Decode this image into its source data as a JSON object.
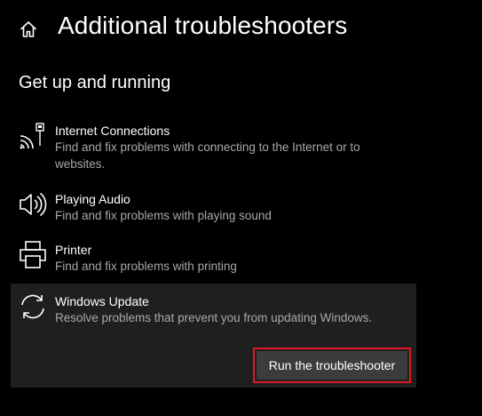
{
  "header": {
    "title": "Additional troubleshooters",
    "home_icon": "home-icon"
  },
  "section": {
    "heading": "Get up and running"
  },
  "items": [
    {
      "icon": "wifi-internet-icon",
      "title": "Internet Connections",
      "description": "Find and fix problems with connecting to the Internet or to websites."
    },
    {
      "icon": "speaker-icon",
      "title": "Playing Audio",
      "description": "Find and fix problems with playing sound"
    },
    {
      "icon": "printer-icon",
      "title": "Printer",
      "description": "Find and fix problems with printing"
    },
    {
      "icon": "sync-icon",
      "title": "Windows Update",
      "description": "Resolve problems that prevent you from updating Windows."
    }
  ],
  "run_button": {
    "label": "Run the troubleshooter"
  },
  "colors": {
    "background": "#000000",
    "selected_item_background": "#1f1f1f",
    "button_background": "#3c3c3c",
    "highlight_border": "#e01922",
    "secondary_text": "#a8a8a8"
  }
}
